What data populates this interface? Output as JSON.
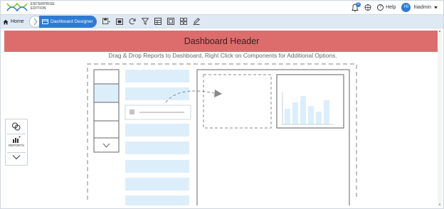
{
  "brand": {
    "edition_line1": "ENTERPRISE",
    "edition_line2": "EDITION",
    "logo_icon": "helical-logo-icon"
  },
  "topbar": {
    "notification_count": "0",
    "help_label": "Help",
    "user_initials": "HI",
    "user_name": "hiadmin"
  },
  "breadcrumb": {
    "home_label": "Home",
    "active_label": "Dashboard Designer"
  },
  "toolbar_icons": [
    "save-icon",
    "preview-icon",
    "refresh-icon",
    "filter-icon",
    "table-icon",
    "layout-icon",
    "grid-icon",
    "edit-icon"
  ],
  "dashboard": {
    "header_text": "Dashboard Header",
    "instruction_text": "Drag & Drop Reports to Dashboard, Right Click on Components for Additional Options."
  },
  "left_panel": {
    "reports_label": "REPORTS"
  },
  "colors": {
    "accent": "#2f7bd3",
    "header_bg": "#dd6d6d",
    "toolbar_bg": "#dfe9f3",
    "illustration_block": "#ddeefb"
  }
}
